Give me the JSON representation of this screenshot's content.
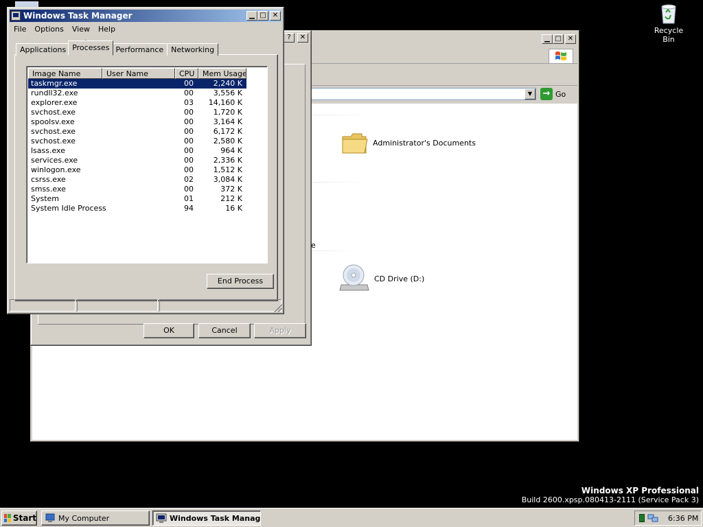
{
  "desktop": {
    "recycle_bin_label": "Recycle Bin",
    "watermark_title": "Windows XP Professional",
    "watermark_build": "Build 2600.xpsp.080413-2111 (Service Pack 3)"
  },
  "explorer": {
    "address_go_label": "Go",
    "items": [
      {
        "label": "Administrator's Documents",
        "icon": "folder-icon"
      },
      {
        "label": "CD Drive (D:)",
        "icon": "cd-drive-icon"
      }
    ],
    "cut_label_fragment": "e"
  },
  "properties_dialog": {
    "ok_label": "OK",
    "cancel_label": "Cancel",
    "apply_label": "Apply"
  },
  "task_manager": {
    "title": "Windows Task Manager",
    "menu": [
      "File",
      "Options",
      "View",
      "Help"
    ],
    "tabs": [
      "Applications",
      "Processes",
      "Performance",
      "Networking"
    ],
    "active_tab": "Processes",
    "columns": [
      "Image Name",
      "User Name",
      "CPU",
      "Mem Usage"
    ],
    "processes": [
      {
        "name": "taskmgr.exe",
        "user": "",
        "cpu": "00",
        "mem": "2,240 K"
      },
      {
        "name": "rundll32.exe",
        "user": "",
        "cpu": "00",
        "mem": "3,556 K"
      },
      {
        "name": "explorer.exe",
        "user": "",
        "cpu": "03",
        "mem": "14,160 K"
      },
      {
        "name": "svchost.exe",
        "user": "",
        "cpu": "00",
        "mem": "1,720 K"
      },
      {
        "name": "spoolsv.exe",
        "user": "",
        "cpu": "00",
        "mem": "3,164 K"
      },
      {
        "name": "svchost.exe",
        "user": "",
        "cpu": "00",
        "mem": "6,172 K"
      },
      {
        "name": "svchost.exe",
        "user": "",
        "cpu": "00",
        "mem": "2,580 K"
      },
      {
        "name": "lsass.exe",
        "user": "",
        "cpu": "00",
        "mem": "964 K"
      },
      {
        "name": "services.exe",
        "user": "",
        "cpu": "00",
        "mem": "2,336 K"
      },
      {
        "name": "winlogon.exe",
        "user": "",
        "cpu": "00",
        "mem": "1,512 K"
      },
      {
        "name": "csrss.exe",
        "user": "",
        "cpu": "02",
        "mem": "3,084 K"
      },
      {
        "name": "smss.exe",
        "user": "",
        "cpu": "00",
        "mem": "372 K"
      },
      {
        "name": "System",
        "user": "",
        "cpu": "01",
        "mem": "212 K"
      },
      {
        "name": "System Idle Process",
        "user": "",
        "cpu": "94",
        "mem": "16 K"
      }
    ],
    "selected_process": "taskmgr.exe",
    "end_process_label": "End Process"
  },
  "taskbar": {
    "start_label": "Start",
    "buttons": [
      {
        "label": "My Computer",
        "active": false
      },
      {
        "label": "Windows Task Manag...",
        "active": true
      }
    ],
    "clock": "6:36 PM"
  },
  "colors": {
    "desktop": "#000000",
    "titlebar_active_start": "#0a246a",
    "titlebar_active_end": "#a6caf0",
    "window_face": "#d4d0c8",
    "selection": "#0a246a"
  }
}
